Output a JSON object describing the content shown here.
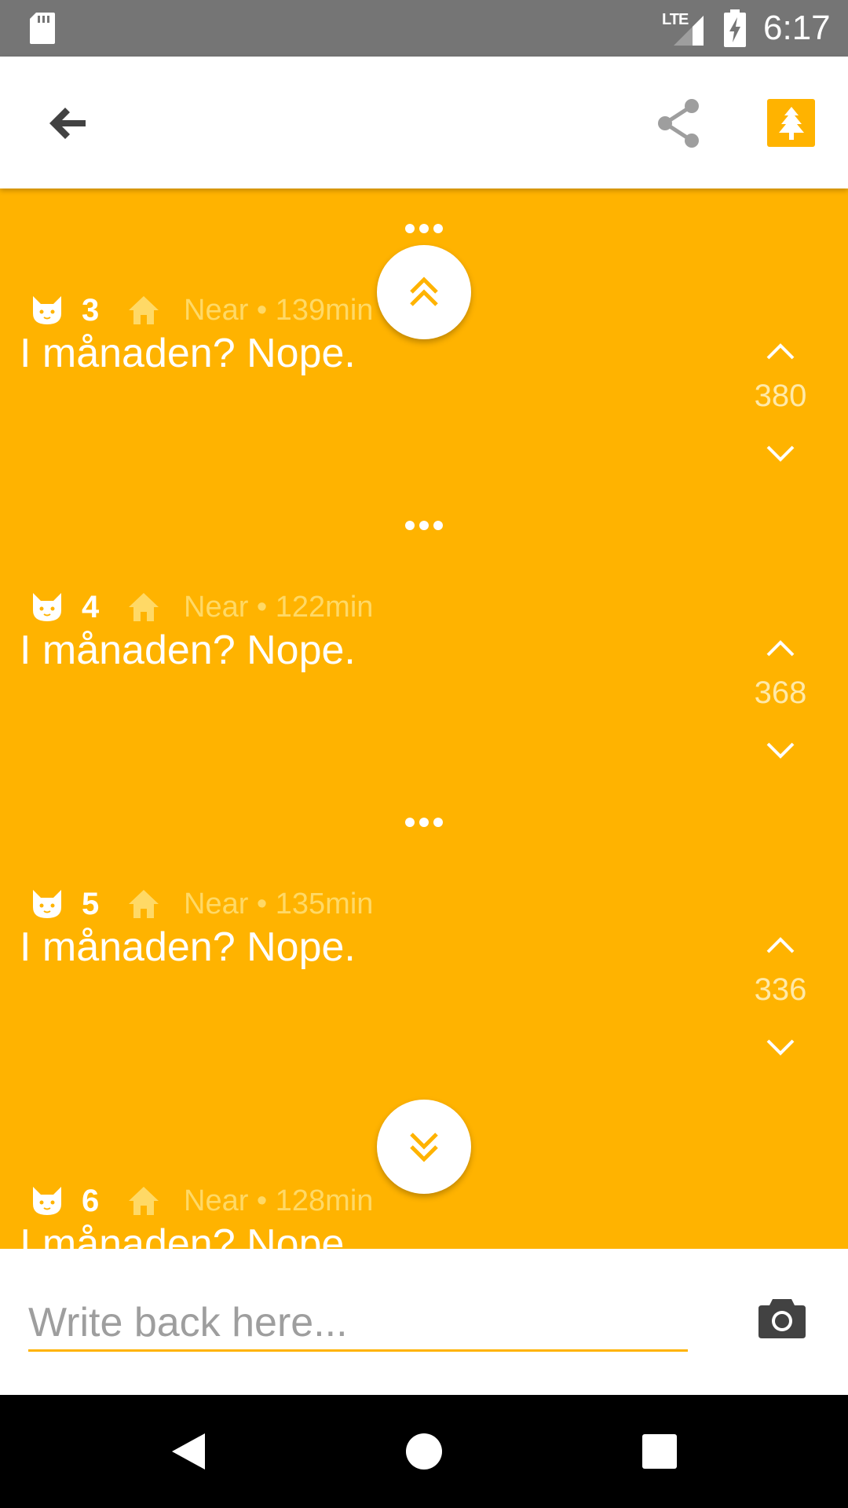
{
  "status_bar": {
    "network_label": "LTE",
    "time": "6:17"
  },
  "toolbar": {
    "icons": [
      "back-arrow-icon",
      "share-icon",
      "tree-icon"
    ],
    "accent_color": "#FFB300"
  },
  "posts": [
    {
      "number": "3",
      "location": "Near • 139min",
      "text": "I månaden? Nope.",
      "votes": "380"
    },
    {
      "number": "4",
      "location": "Near • 122min",
      "text": "I månaden? Nope.",
      "votes": "368"
    },
    {
      "number": "5",
      "location": "Near • 135min",
      "text": "I månaden? Nope.",
      "votes": "336"
    },
    {
      "number": "6",
      "location": "Near • 128min",
      "text": "I månaden? Nope.",
      "votes": ""
    }
  ],
  "compose": {
    "placeholder": "Write back here...",
    "value": ""
  },
  "colors": {
    "background": "#FFB300",
    "status_bar": "#757575",
    "meta_text": "#FFD966"
  }
}
